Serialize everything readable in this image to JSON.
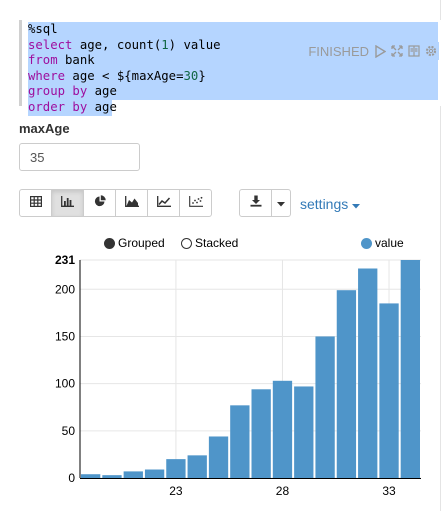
{
  "editor": {
    "lines": [
      "%sql",
      "select age, count(1) value",
      "from bank",
      "where age < ${maxAge=30}",
      "group by age",
      "order by age"
    ],
    "status": "FINISHED"
  },
  "form": {
    "label": "maxAge",
    "value": "35"
  },
  "toolbar": {
    "settings_label": "settings"
  },
  "legend": {
    "grouped": "Grouped",
    "stacked": "Stacked",
    "series": "value"
  },
  "icons": [
    "play-icon",
    "expand-icon",
    "book-icon",
    "gear-icon",
    "table-icon",
    "bar-chart-icon",
    "pie-chart-icon",
    "area-chart-icon",
    "line-chart-icon",
    "scatter-chart-icon",
    "download-icon",
    "caret-down-icon"
  ],
  "colors": {
    "bar": "#4f95c9",
    "selection": "#b5d5ff",
    "keyword": "#9e0e9e",
    "link": "#337ab7"
  },
  "chart_data": {
    "type": "bar",
    "x": [
      19,
      20,
      21,
      22,
      23,
      24,
      25,
      26,
      27,
      28,
      29,
      30,
      31,
      32,
      33,
      34
    ],
    "values": [
      4,
      3,
      7,
      9,
      20,
      24,
      44,
      77,
      94,
      103,
      97,
      150,
      199,
      222,
      185,
      231
    ],
    "x_tick_labels": [
      "23",
      "28",
      "33"
    ],
    "y_ticks": [
      0,
      50,
      100,
      150,
      200
    ],
    "y_max_label": "231",
    "ylim": [
      0,
      231
    ],
    "series": [
      {
        "name": "value"
      }
    ],
    "grid": true,
    "legend": "top-right"
  }
}
